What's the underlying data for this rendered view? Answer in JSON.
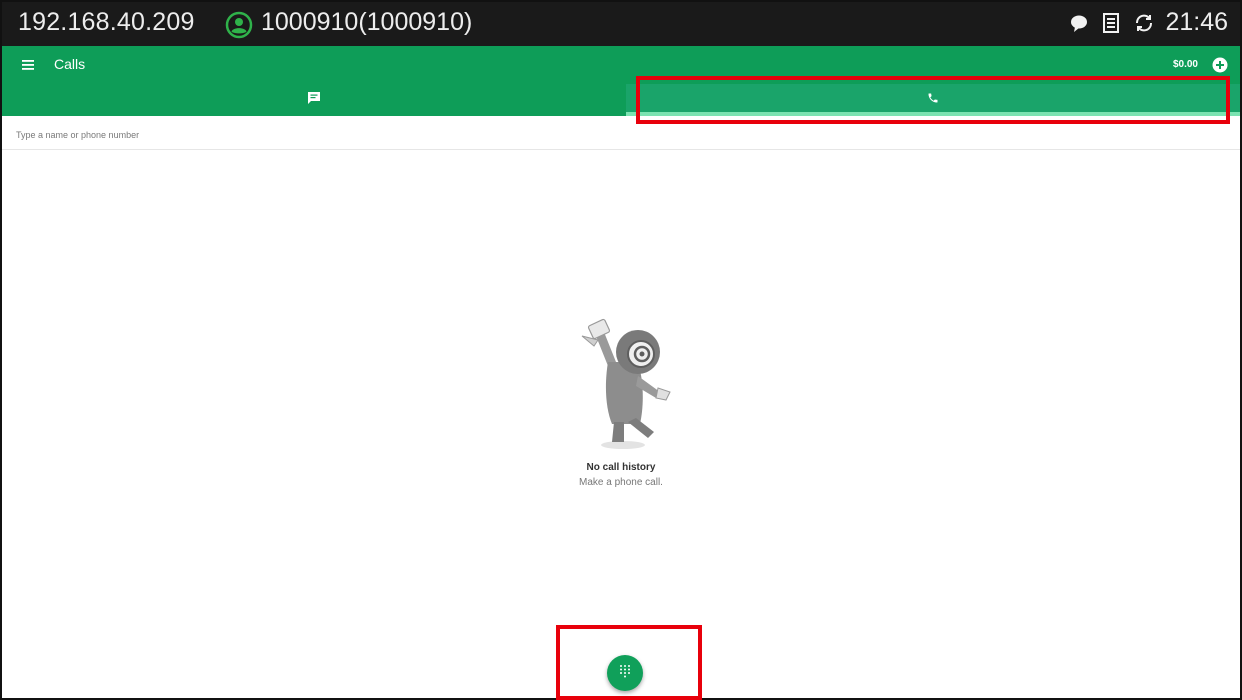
{
  "status_bar": {
    "ip_address": "192.168.40.209",
    "account": "1000910(1000910)",
    "time": "21:46",
    "icons": [
      "account-icon",
      "chat-bubble-icon",
      "sim-card-icon",
      "sync-icon"
    ]
  },
  "app_bar": {
    "title": "Calls",
    "balance": "$0.00"
  },
  "tabs": [
    {
      "name": "messages",
      "icon": "message-icon",
      "selected": false
    },
    {
      "name": "calls",
      "icon": "phone-icon",
      "selected": true
    }
  ],
  "search": {
    "placeholder": "Type a name or phone number",
    "value": ""
  },
  "empty_state": {
    "title": "No call history",
    "subtitle": "Make a phone call."
  },
  "fab": {
    "icon": "dialpad-icon"
  },
  "colors": {
    "primary": "#0e9d58",
    "tab_selected": "#1aa46a",
    "tab_indicator": "#7be3b1",
    "status_bar": "#1a1a1a",
    "highlight": "#e8000b"
  }
}
